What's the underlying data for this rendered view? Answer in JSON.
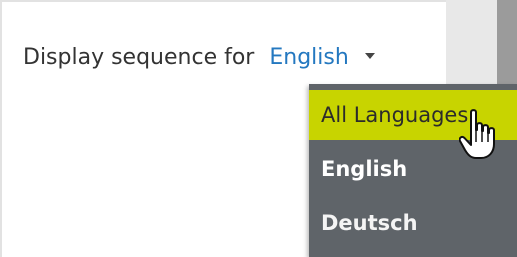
{
  "display_sequence": {
    "label": "Display sequence for",
    "selected_language": "English"
  },
  "language_menu": {
    "items": [
      {
        "label": "All Languages",
        "state": "hovered"
      },
      {
        "label": "English",
        "state": "normal"
      },
      {
        "label": "Deutsch",
        "state": "normal"
      }
    ]
  },
  "colors": {
    "link": "#2478c0",
    "menu_background": "#5f6469",
    "hover_highlight": "#c8d400"
  },
  "icons": {
    "caret": "caret-down-icon",
    "cursor": "hand-pointer-icon"
  }
}
